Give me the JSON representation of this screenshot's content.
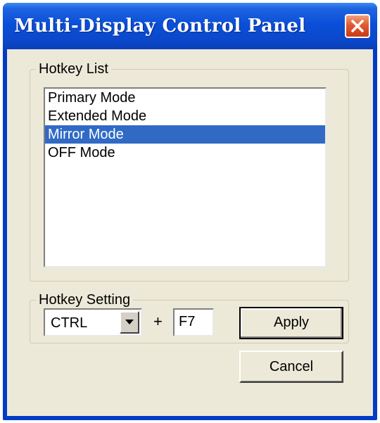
{
  "window": {
    "title": "Multi-Display Control Panel",
    "close_icon": "close-icon"
  },
  "hotkey_list": {
    "label": "Hotkey List",
    "items": [
      {
        "label": "Primary Mode",
        "selected": false
      },
      {
        "label": "Extended Mode",
        "selected": false
      },
      {
        "label": "Mirror Mode",
        "selected": true
      },
      {
        "label": "OFF Mode",
        "selected": false
      }
    ]
  },
  "hotkey_setting": {
    "label": "Hotkey Setting",
    "modifier": "CTRL",
    "plus": "+",
    "key": "F7",
    "apply_label": "Apply"
  },
  "cancel_label": "Cancel",
  "colors": {
    "titlebar": "#0b48cb",
    "selection": "#316ac5",
    "dialog_bg": "#ece9d8",
    "close_button": "#e05a30"
  }
}
